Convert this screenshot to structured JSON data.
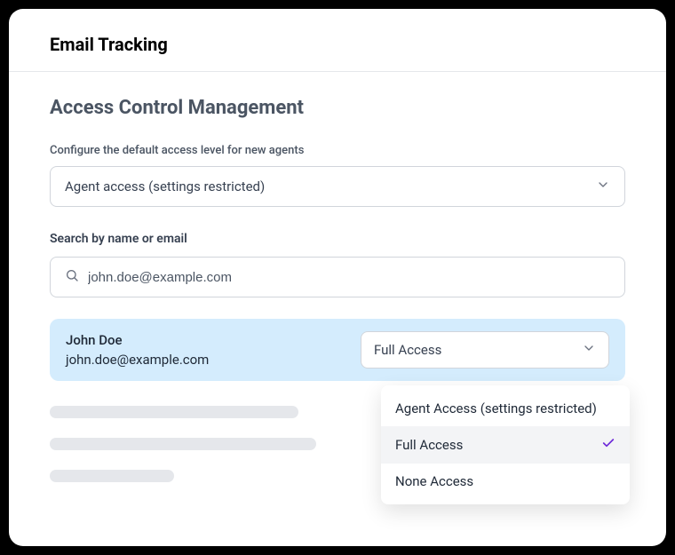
{
  "header": {
    "title": "Email Tracking"
  },
  "page": {
    "title": "Access Control Management",
    "default_label": "Configure the default access level for new agents",
    "default_value": "Agent access (settings restricted)",
    "search_label": "Search by name or email",
    "search_value": "john.doe@example.com"
  },
  "user": {
    "name": "John Doe",
    "email": "john.doe@example.com",
    "access_value": "Full Access"
  },
  "dropdown": {
    "options": [
      {
        "label": "Agent Access  (settings restricted)",
        "selected": false
      },
      {
        "label": "Full Access",
        "selected": true
      },
      {
        "label": "None Access",
        "selected": false
      }
    ]
  }
}
